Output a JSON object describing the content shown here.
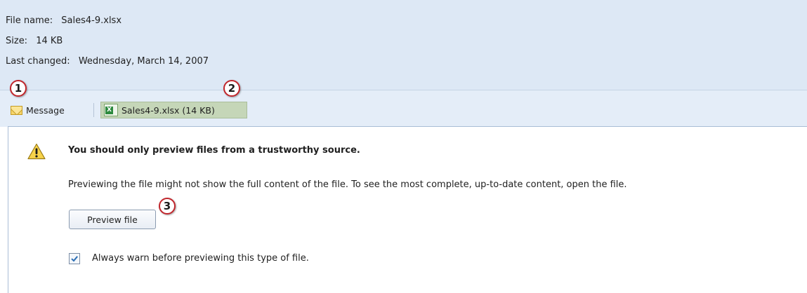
{
  "file_info": {
    "name_label": "File name:",
    "name_value": "Sales4-9.xlsx",
    "size_label": "Size:",
    "size_value": "14 KB",
    "changed_label": "Last changed:",
    "changed_value": "Wednesday, March 14, 2007"
  },
  "tabs": {
    "message_label": "Message",
    "message_icon": "envelope-icon",
    "attachment_label": "Sales4-9.xlsx (14 KB)",
    "attachment_icon": "excel-file-icon"
  },
  "warning": {
    "icon": "warning-triangle-icon",
    "title": "You should only preview files from a trustworthy source.",
    "body": "Previewing the file might not show the full content of the file. To see the most complete, up-to-date content, open the file.",
    "preview_button_label": "Preview file",
    "checkbox_label": "Always warn before previewing this type of file.",
    "checkbox_checked": true
  },
  "callouts": [
    "1",
    "2",
    "3"
  ],
  "colors": {
    "header_bg": "#dde8f5",
    "selected_tab_bg": "#c5d6b8",
    "callout_border": "#c1262c"
  }
}
